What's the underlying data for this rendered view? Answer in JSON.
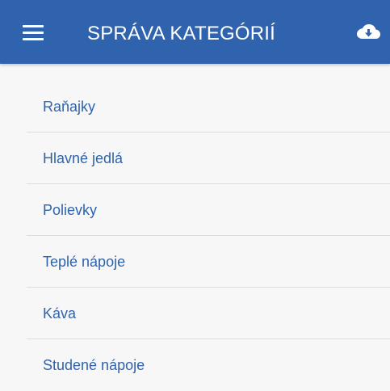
{
  "app_bar": {
    "title": "SPRÁVA KATEGÓRIÍ",
    "menu_icon": "menu-icon",
    "action_icon": "cloud-download-icon"
  },
  "categories": [
    {
      "label": "Raňajky"
    },
    {
      "label": "Hlavné jedlá"
    },
    {
      "label": "Polievky"
    },
    {
      "label": "Teplé nápoje"
    },
    {
      "label": "Káva"
    },
    {
      "label": "Studené nápoje"
    }
  ],
  "colors": {
    "primary": "#2f63ad",
    "background": "#f7f7f7",
    "divider": "#dddddd"
  }
}
